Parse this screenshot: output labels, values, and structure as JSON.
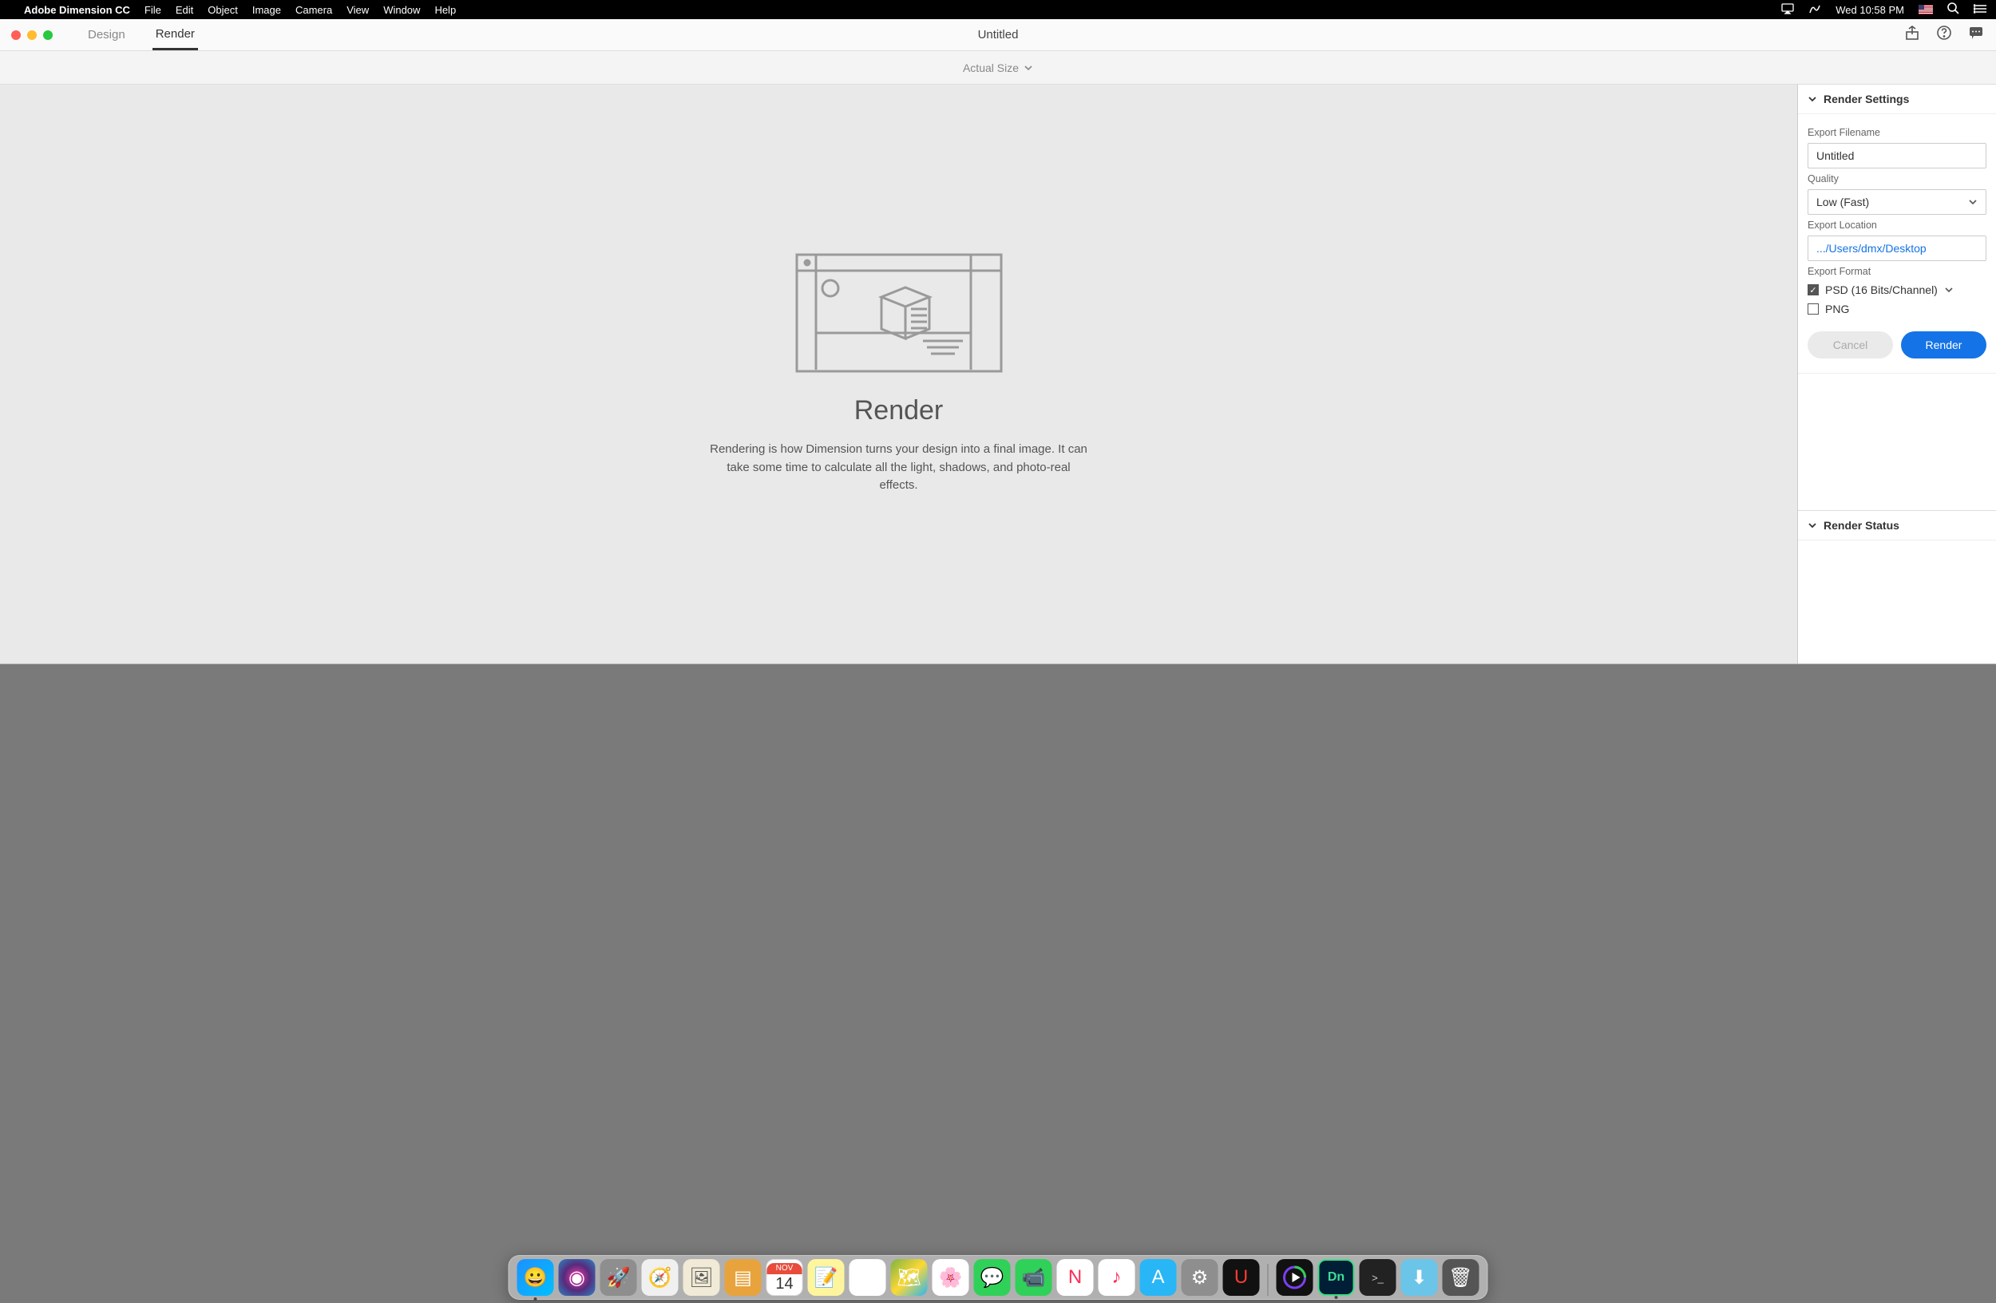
{
  "menubar": {
    "app_name": "Adobe Dimension CC",
    "items": [
      "File",
      "Edit",
      "Object",
      "Image",
      "Camera",
      "View",
      "Window",
      "Help"
    ],
    "clock": "Wed 10:58 PM"
  },
  "window": {
    "tabs": {
      "design": "Design",
      "render": "Render"
    },
    "doc_title": "Untitled",
    "zoom_label": "Actual Size"
  },
  "canvas": {
    "heading": "Render",
    "description": "Rendering is how Dimension turns your design into a final image. It can take some time to calculate all the light, shadows, and photo-real effects."
  },
  "panel": {
    "settings_header": "Render Settings",
    "status_header": "Render Status",
    "filename_label": "Export Filename",
    "filename_value": "Untitled",
    "quality_label": "Quality",
    "quality_value": "Low (Fast)",
    "location_label": "Export Location",
    "location_value": ".../Users/dmx/Desktop",
    "format_label": "Export Format",
    "format_psd": "PSD (16 Bits/Channel)",
    "format_png": "PNG",
    "cancel": "Cancel",
    "render": "Render"
  },
  "dock": {
    "cal_month": "NOV",
    "cal_day": "14",
    "dn": "Dn"
  }
}
